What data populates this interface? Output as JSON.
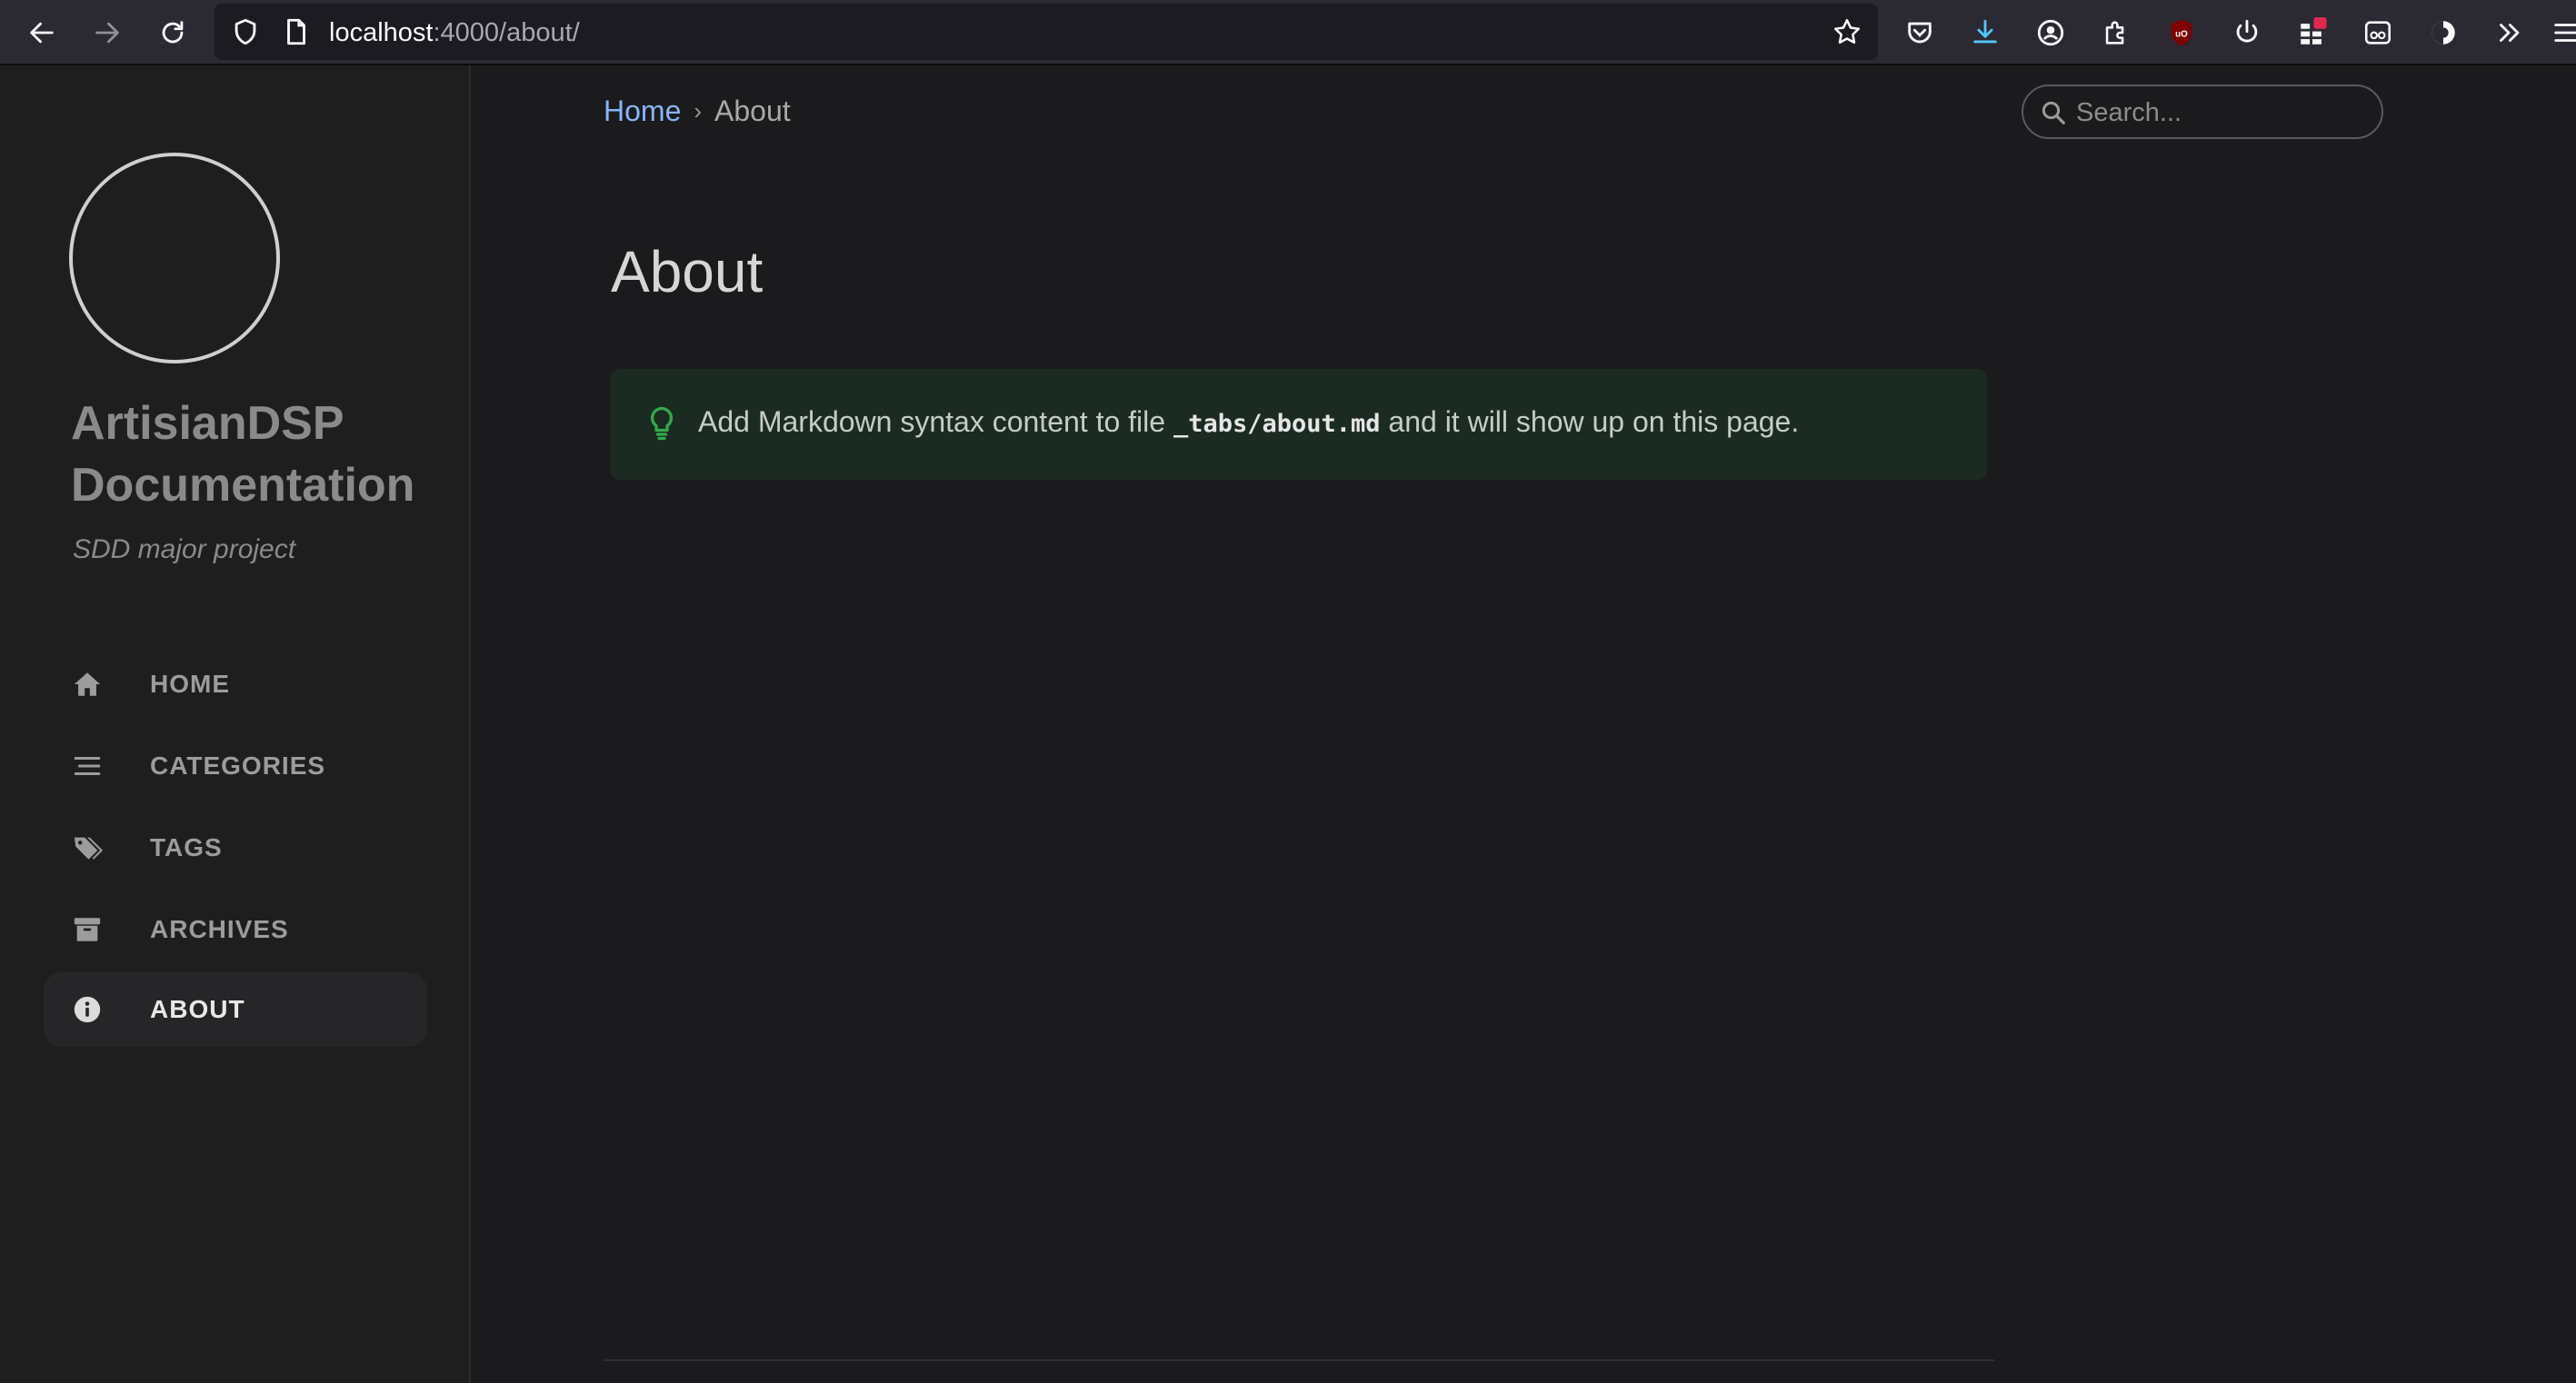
{
  "browser": {
    "url_host": "localhost",
    "url_path": ":4000/about/"
  },
  "sidebar": {
    "site_title": "ArtisianDSP Documentation",
    "subtitle": "SDD major project",
    "items": [
      {
        "label": "HOME",
        "icon": "home-icon",
        "active": false
      },
      {
        "label": "CATEGORIES",
        "icon": "list-icon",
        "active": false
      },
      {
        "label": "TAGS",
        "icon": "tags-icon",
        "active": false
      },
      {
        "label": "ARCHIVES",
        "icon": "archive-icon",
        "active": false
      },
      {
        "label": "ABOUT",
        "icon": "info-icon",
        "active": true
      }
    ]
  },
  "main": {
    "breadcrumb": {
      "home": "Home",
      "separator": "›",
      "current": "About"
    },
    "search_placeholder": "Search...",
    "title": "About",
    "tip": {
      "prefix": "Add Markdown syntax content to file ",
      "code": "_tabs/about.md",
      "suffix": " and it will show up on this page."
    }
  },
  "colors": {
    "background": "#1b1b1e",
    "sidebar": "#1e1e1e",
    "link": "#8ab4f8",
    "tip_background": "#1b2b22",
    "tip_icon": "#35a84c"
  }
}
